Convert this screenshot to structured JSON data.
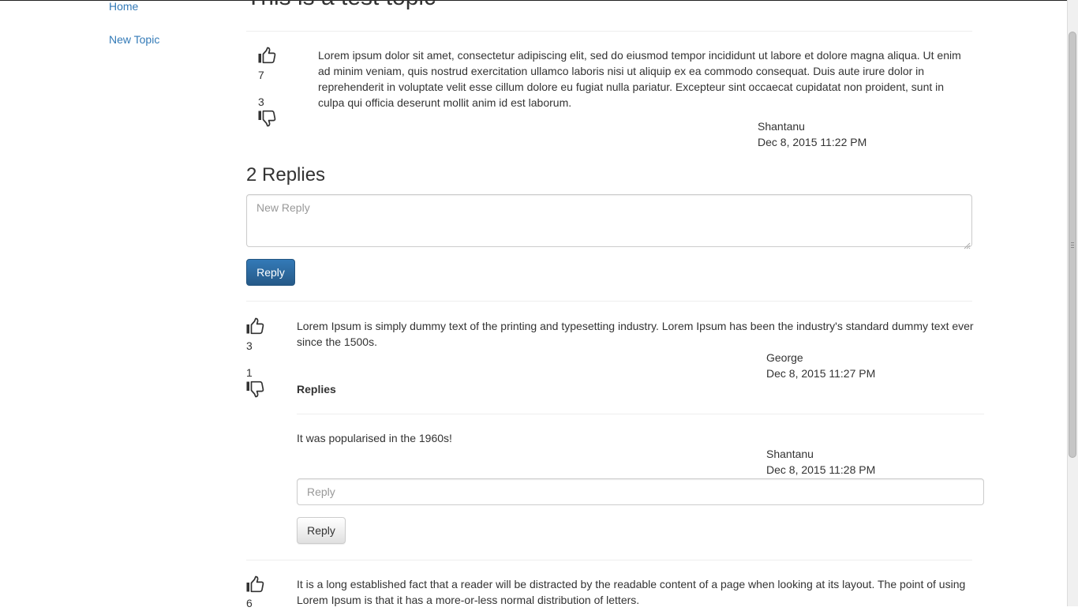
{
  "sidebar": {
    "home_label": "Home",
    "new_topic_label": "New Topic"
  },
  "topic": {
    "title": "This is a test topic",
    "upvotes": "7",
    "downvotes": "3",
    "body": "Lorem ipsum dolor sit amet, consectetur adipiscing elit, sed do eiusmod tempor incididunt ut labore et dolore magna aliqua. Ut enim ad minim veniam, quis nostrud exercitation ullamco laboris nisi ut aliquip ex ea commodo consequat. Duis aute irure dolor in reprehenderit in voluptate velit esse cillum dolore eu fugiat nulla pariatur. Excepteur sint occaecat cupidatat non proident, sunt in culpa qui officia deserunt mollit anim id est laborum.",
    "author": "Shantanu",
    "date": "Dec 8, 2015 11:22 PM"
  },
  "replies_section": {
    "heading": "2 Replies",
    "new_reply_placeholder": "New Reply",
    "reply_button_label": "Reply"
  },
  "replies": [
    {
      "upvotes": "3",
      "downvotes": "1",
      "body": "Lorem Ipsum is simply dummy text of the printing and typesetting industry. Lorem Ipsum has been the industry's standard dummy text ever since the 1500s.",
      "author": "George",
      "date": "Dec 8, 2015 11:27 PM",
      "nested_heading": "Replies",
      "nested": [
        {
          "body": "It was popularised in the 1960s!",
          "author": "Shantanu",
          "date": "Dec 8, 2015 11:28 PM"
        }
      ],
      "reply_placeholder": "Reply",
      "reply_button_label": "Reply"
    },
    {
      "upvotes": "6",
      "body": "It is a long established fact that a reader will be distracted by the readable content of a page when looking at its layout. The point of using Lorem Ipsum is that it has a more-or-less normal distribution of letters."
    }
  ],
  "icons": {
    "upvote": "thumbs-up-icon",
    "downvote": "thumbs-down-icon"
  },
  "colors": {
    "link": "#337ab7",
    "primary_button": "#337ab7",
    "text": "#333333",
    "divider": "#eeeeee"
  }
}
